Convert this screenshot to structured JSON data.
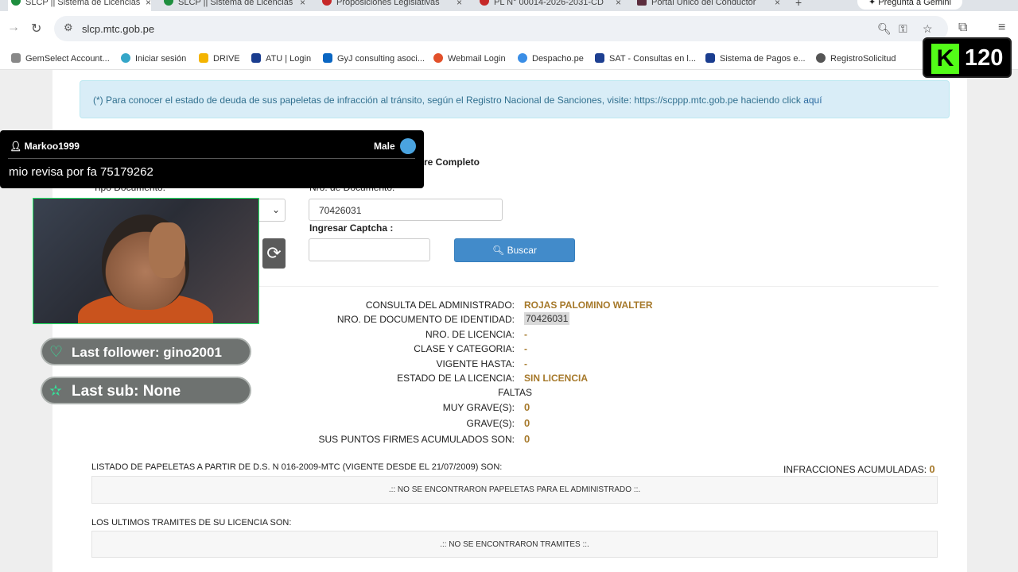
{
  "browser": {
    "tabs": [
      {
        "label": "SLCP || Sistema de Licencias",
        "color": "#1e8e3e"
      },
      {
        "label": "SLCP || Sistema de Licencias",
        "color": "#1e8e3e"
      },
      {
        "label": "Proposiciones Legislativas",
        "color": "#c62828"
      },
      {
        "label": "PL N° 00014-2026-2031-CD",
        "color": "#c62828"
      },
      {
        "label": "Portal Único del Conductor",
        "color": "#5b2d3d"
      }
    ],
    "new_tab": "+",
    "gemini_label": "Pregunta a Gemini",
    "url": "slcp.mtc.gob.pe",
    "bookmarks": [
      {
        "label": "GemSelect Account...",
        "color": "#888"
      },
      {
        "label": "Iniciar sesión",
        "color": "#35a6c8"
      },
      {
        "label": "DRIVE",
        "color": "#f4b400"
      },
      {
        "label": "ATU | Login",
        "color": "#1a3d8f"
      },
      {
        "label": "GyJ consulting asoci...",
        "color": "#0a66c2"
      },
      {
        "label": "Webmail Login",
        "color": "#e2502a"
      },
      {
        "label": "Despacho.pe",
        "color": "#3a8ee6"
      },
      {
        "label": "SAT - Consultas en l...",
        "color": "#1d3f91"
      },
      {
        "label": "Sistema de Pagos e...",
        "color": "#1a3d8f"
      },
      {
        "label": "RegistroSolicitud",
        "color": "#555"
      }
    ]
  },
  "page": {
    "alert_text": "(*) Para conocer el estado de deuda de sus papeletas de infracción al tránsito, según el Registro Nacional de Sanciones, visite: https://scppp.mtc.gob.pe haciendo click ",
    "alert_link": "aquí",
    "radio_label_fragment": "re Completo",
    "tipo_documento_label": "Tipo Documento:",
    "nro_documento_label": "Nro. de Documento:",
    "nro_documento_value": "70426031",
    "captcha_label": "Ingresar Captcha :",
    "buscar_label": "Buscar",
    "results": [
      {
        "label": "CONSULTA DEL ADMINISTRADO:",
        "value": "ROJAS PALOMINO WALTER"
      },
      {
        "label": "NRO. DE DOCUMENTO DE IDENTIDAD:",
        "value": "70426031"
      },
      {
        "label": "NRO. DE LICENCIA:",
        "value": "-"
      },
      {
        "label": "CLASE Y CATEGORIA:",
        "value": "-"
      },
      {
        "label": "VIGENTE HASTA:",
        "value": "-"
      },
      {
        "label": "ESTADO DE LA LICENCIA:",
        "value": "SIN LICENCIA"
      }
    ],
    "faltas_label": "FALTAS",
    "faltas": [
      {
        "label": "MUY GRAVE(S):",
        "value": "0"
      },
      {
        "label": "GRAVE(S):",
        "value": "0"
      },
      {
        "label": "SUS PUNTOS FIRMES ACUMULADOS SON:",
        "value": "0"
      }
    ],
    "papeletas_title": "LISTADO DE PAPELETAS A PARTIR DE D.S. N 016-2009-MTC (VIGENTE DESDE EL 21/07/2009) SON:",
    "infracciones_label": "INFRACCIONES ACUMULADAS:",
    "infracciones_value": "0",
    "papeletas_empty": ".:: NO SE ENCONTRARON PAPELETAS PARA EL ADMINISTRADO ::.",
    "tramites_title": "LOS ULTIMOS TRAMITES DE SU LICENCIA SON:",
    "tramites_empty": ".:: NO SE ENCONTRARON TRAMITES ::."
  },
  "overlay": {
    "chat_user": "Markoo1999",
    "chat_gender": "Male",
    "chat_message": "mio revisa por fa 75179262",
    "last_follower": "Last follower: gino2001",
    "last_sub": "Last sub: None",
    "kick_count": "120"
  }
}
